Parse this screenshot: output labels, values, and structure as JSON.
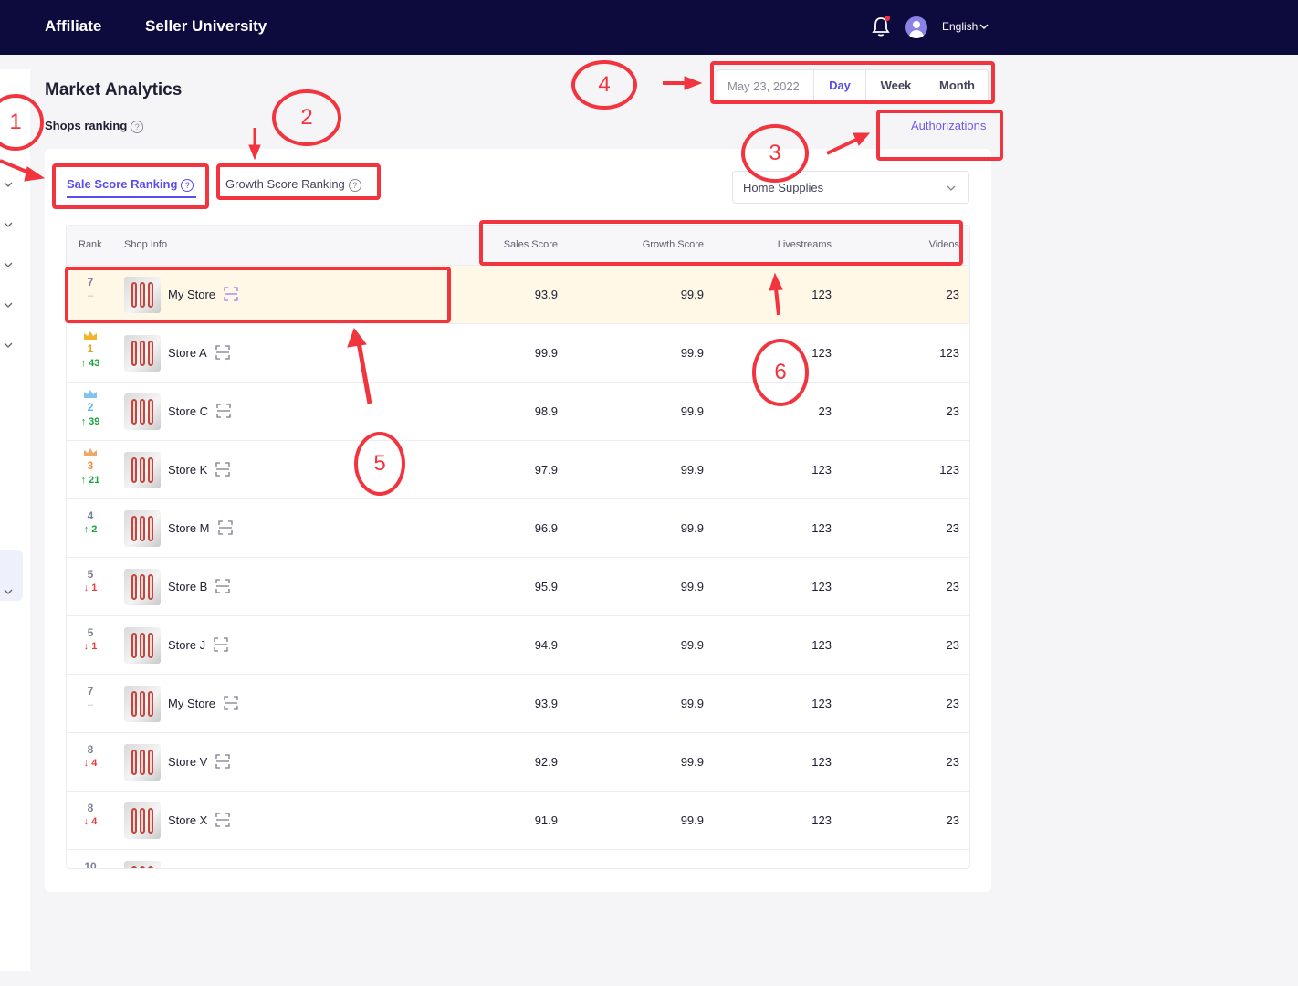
{
  "topbar": {
    "links": [
      "Affiliate",
      "Seller University"
    ],
    "language": "English"
  },
  "page": {
    "title": "Market Analytics",
    "section_label": "Shops ranking",
    "authorizations_link": "Authorizations"
  },
  "period": {
    "date": "May 23, 2022",
    "options": [
      "Day",
      "Week",
      "Month"
    ],
    "selected": "Day"
  },
  "tabs": [
    {
      "label": "Sale Score Ranking",
      "active": true
    },
    {
      "label": "Growth Score Ranking",
      "active": false
    }
  ],
  "category_select": {
    "value": "Home Supplies"
  },
  "table": {
    "columns": [
      "Rank",
      "Shop Info",
      "Sales Score",
      "Growth Score",
      "Livestreams",
      "Videos"
    ],
    "rows": [
      {
        "rank": "7",
        "change": "–",
        "direction": "none",
        "shop": "My Store",
        "sales_score": "93.9",
        "growth_score": "99.9",
        "livestreams": "123",
        "videos": "23",
        "highlight": true
      },
      {
        "rank": "1",
        "change": "43",
        "direction": "up",
        "crown": "gold",
        "shop": "Store A",
        "sales_score": "99.9",
        "growth_score": "99.9",
        "livestreams": "123",
        "videos": "123"
      },
      {
        "rank": "2",
        "change": "39",
        "direction": "up",
        "crown": "silver",
        "shop": "Store C",
        "sales_score": "98.9",
        "growth_score": "99.9",
        "livestreams": "23",
        "videos": "23"
      },
      {
        "rank": "3",
        "change": "21",
        "direction": "up",
        "crown": "bronze",
        "shop": "Store K",
        "sales_score": "97.9",
        "growth_score": "99.9",
        "livestreams": "123",
        "videos": "123"
      },
      {
        "rank": "4",
        "change": "2",
        "direction": "up",
        "shop": "Store M",
        "sales_score": "96.9",
        "growth_score": "99.9",
        "livestreams": "123",
        "videos": "23"
      },
      {
        "rank": "5",
        "change": "1",
        "direction": "down",
        "shop": "Store B",
        "sales_score": "95.9",
        "growth_score": "99.9",
        "livestreams": "123",
        "videos": "23"
      },
      {
        "rank": "5",
        "change": "1",
        "direction": "down",
        "shop": "Store J",
        "sales_score": "94.9",
        "growth_score": "99.9",
        "livestreams": "123",
        "videos": "23"
      },
      {
        "rank": "7",
        "change": "–",
        "direction": "none",
        "shop": "My Store",
        "sales_score": "93.9",
        "growth_score": "99.9",
        "livestreams": "123",
        "videos": "23"
      },
      {
        "rank": "8",
        "change": "4",
        "direction": "down",
        "shop": "Store V",
        "sales_score": "92.9",
        "growth_score": "99.9",
        "livestreams": "123",
        "videos": "23"
      },
      {
        "rank": "8",
        "change": "4",
        "direction": "down",
        "shop": "Store X",
        "sales_score": "91.9",
        "growth_score": "99.9",
        "livestreams": "123",
        "videos": "23"
      },
      {
        "rank": "10",
        "change": "",
        "direction": "none",
        "shop": "",
        "sales_score": "",
        "growth_score": "",
        "livestreams": "",
        "videos": ""
      }
    ]
  },
  "annotations": [
    "1",
    "2",
    "3",
    "4",
    "5",
    "6"
  ],
  "colors": {
    "topbar": "#0d0b3d",
    "accent": "#5b4cf0",
    "annotation": "#f2343f",
    "up": "#1aa33b",
    "down": "#e83b3b",
    "highlight_row": "#fff8e6"
  }
}
